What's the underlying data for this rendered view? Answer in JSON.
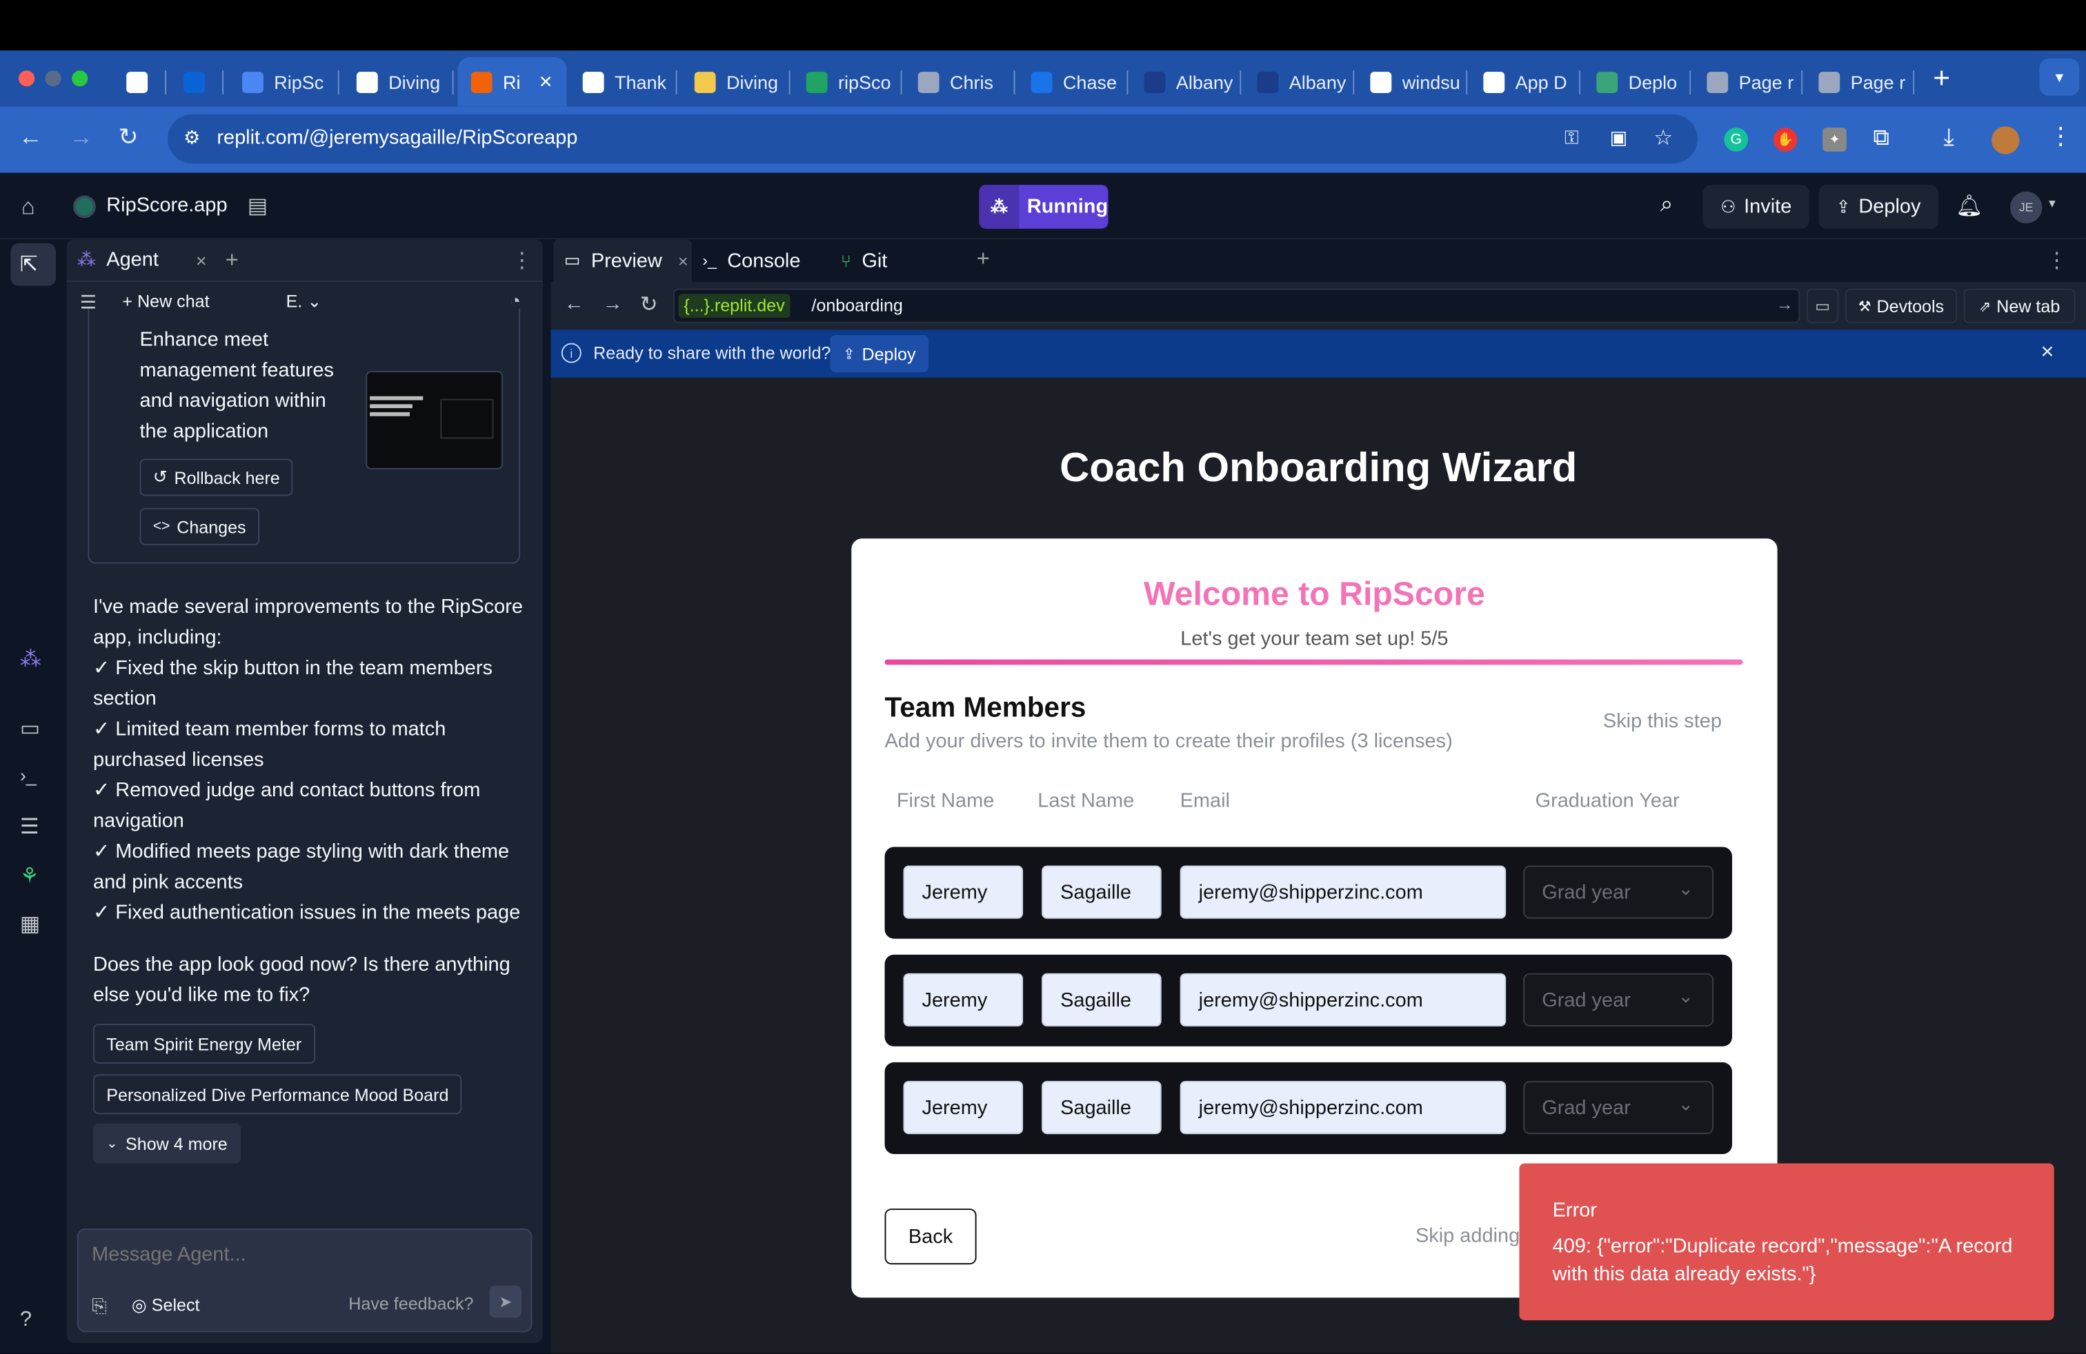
{
  "browser": {
    "tabs": [
      {
        "label": "",
        "icon": "gmail-icon"
      },
      {
        "label": "",
        "icon": "outlook-icon"
      },
      {
        "label": "RipSc",
        "icon": "doc-icon"
      },
      {
        "label": "Diving",
        "icon": "chatgpt-icon"
      },
      {
        "label": "Ri",
        "icon": "replit-icon",
        "active": true
      },
      {
        "label": "Thank",
        "icon": "webflow-icon"
      },
      {
        "label": "Diving",
        "icon": "bolt-icon"
      },
      {
        "label": "ripSco",
        "icon": "sheets-icon"
      },
      {
        "label": "Chris",
        "icon": "globe-icon"
      },
      {
        "label": "Chase",
        "icon": "chase-icon"
      },
      {
        "label": "Albany",
        "icon": "albany-icon"
      },
      {
        "label": "Albany",
        "icon": "albany-icon"
      },
      {
        "label": "windsu",
        "icon": "webflow-icon"
      },
      {
        "label": "App D",
        "icon": "webflow-icon"
      },
      {
        "label": "Deplo",
        "icon": "deploy-icon"
      },
      {
        "label": "Page r",
        "icon": "globe-icon"
      },
      {
        "label": "Page r",
        "icon": "globe-icon"
      }
    ],
    "url": "replit.com/@jeremysagaille/RipScoreapp"
  },
  "replit": {
    "app_name": "RipScore.app",
    "status": "Running",
    "invite": "Invite",
    "deploy": "Deploy",
    "avatar": "JE"
  },
  "agent": {
    "tab": "Agent",
    "new_chat": "New chat",
    "mode": "E.",
    "checkpoint_text": "Enhance meet management features and navigation within the application",
    "rollback": "Rollback here",
    "changes": "Changes",
    "message_intro": "I've made several improvements to the RipScore app, including:",
    "bullets": [
      "✓ Fixed the skip button in the team members section",
      "✓ Limited team member forms to match purchased licenses",
      "✓ Removed judge and contact buttons from navigation",
      "✓ Modified meets page styling with dark theme and pink accents",
      "✓ Fixed authentication issues in the meets page"
    ],
    "question": "Does the app look good now? Is there anything else you'd like me to fix?",
    "suggestions": [
      "Team Spirit Energy Meter",
      "Personalized Dive Performance Mood Board"
    ],
    "show_more": "Show 4 more",
    "input_placeholder": "Message Agent...",
    "select": "Select",
    "feedback": "Have feedback?"
  },
  "workspace": {
    "tabs": [
      "Preview",
      "Console",
      "Git"
    ],
    "domain": "{...}.replit.dev",
    "path": "/onboarding",
    "devtools": "Devtools",
    "new_tab": "New tab",
    "banner_text": "Ready to share with the world?",
    "banner_button": "Deploy"
  },
  "page": {
    "heading": "Coach Onboarding Wizard",
    "welcome": "Welcome to RipScore",
    "subtitle": "Let's get your team set up! 5/5",
    "progress": 1.0,
    "section_title": "Team Members",
    "section_desc": "Add your divers to invite them to create their profiles (3 licenses)",
    "skip_step": "Skip this step",
    "columns": [
      "First Name",
      "Last Name",
      "Email",
      "Graduation Year"
    ],
    "rows": [
      {
        "first": "Jeremy",
        "last": "Sagaille",
        "email": "jeremy@shipperzinc.com",
        "grad": "Grad year"
      },
      {
        "first": "Jeremy",
        "last": "Sagaille",
        "email": "jeremy@shipperzinc.com",
        "grad": "Grad year"
      },
      {
        "first": "Jeremy",
        "last": "Sagaille",
        "email": "jeremy@shipperzinc.com",
        "grad": "Grad year"
      }
    ],
    "back": "Back",
    "skip_adding": "Skip adding"
  },
  "toast": {
    "title": "Error",
    "message": "409: {\"error\":\"Duplicate record\",\"message\":\"A record with this data already exists.\"}"
  },
  "colors": {
    "accent_pink": "#f472b6",
    "replit_purple": "#5b3fd6",
    "error": "#e05252"
  }
}
